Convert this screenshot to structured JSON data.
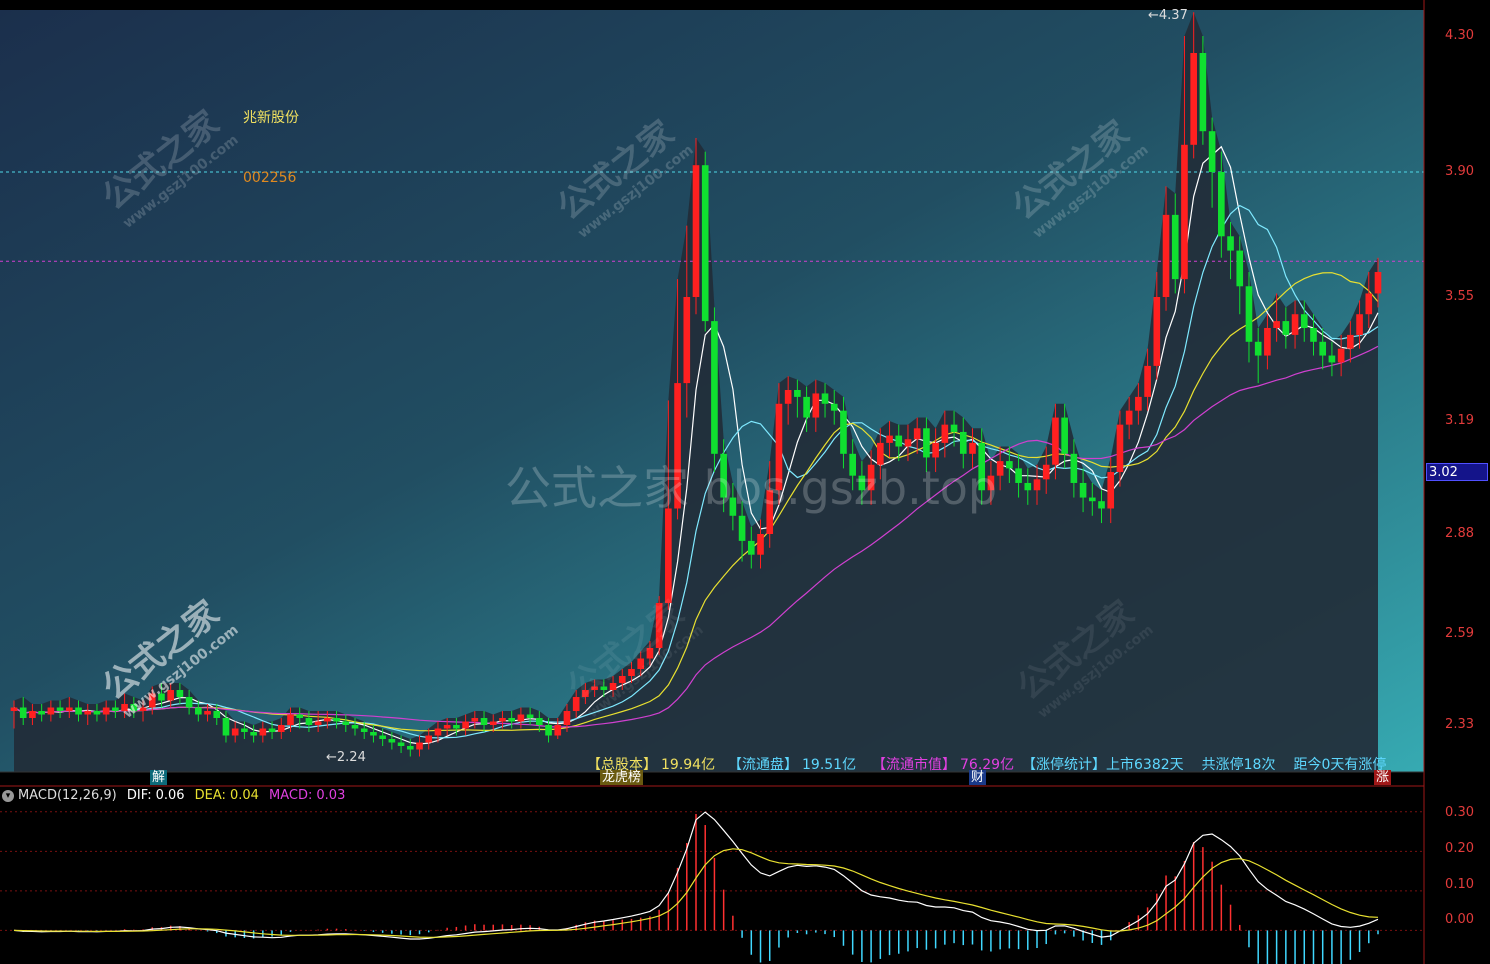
{
  "stock": {
    "name": "兆新股份",
    "code": "002256"
  },
  "colors": {
    "up": "#ff2020",
    "down": "#10e030",
    "ma5": "#ffffff",
    "ma10": "#7fe9ff",
    "ma20": "#e8e030",
    "ma60": "#d040d0",
    "axis": "#e23b3b",
    "dif": "#ffffff",
    "dea": "#e8e030",
    "macd": "#d040d0"
  },
  "price_axis": {
    "ticks": [
      "4.30",
      "3.90",
      "3.55",
      "3.19",
      "2.88",
      "2.59",
      "2.33"
    ],
    "current": "3.02"
  },
  "annotations": {
    "high": "4.37",
    "low": "2.24"
  },
  "markers": {
    "m1": "解",
    "m2": "龙虎榜",
    "m3": "财",
    "m4": "涨"
  },
  "stats": {
    "total_label": "【总股本】",
    "total_value": "19.94亿",
    "float_label": "【流通盘】",
    "float_value": "19.51亿",
    "mcap_label": "【流通市值】",
    "mcap_value": "76.29亿",
    "limit_label": "【涨停统计】",
    "limit_value": "上市6382天",
    "limit_count": "共涨停18次",
    "limit_recent": "距今0天有涨停"
  },
  "macd": {
    "title": "MACD(12,26,9)",
    "dif_label": "DIF:",
    "dif_value": "0.06",
    "dea_label": "DEA:",
    "dea_value": "0.04",
    "macd_label": "MACD:",
    "macd_value": "0.03",
    "ticks": [
      "0.30",
      "0.20",
      "0.10",
      "0.00"
    ]
  },
  "watermark": {
    "center": "公式之家 bbs.gszb.top",
    "corner_cn": "公式之家",
    "corner_url": "www.gszj100.com"
  },
  "chart_data": {
    "type": "candlestick",
    "candles": [
      [
        2.37,
        2.38,
        2.32,
        2.4
      ],
      [
        2.38,
        2.35,
        2.33,
        2.41
      ],
      [
        2.35,
        2.37,
        2.33,
        2.39
      ],
      [
        2.37,
        2.36,
        2.34,
        2.39
      ],
      [
        2.36,
        2.38,
        2.34,
        2.4
      ],
      [
        2.38,
        2.37,
        2.35,
        2.4
      ],
      [
        2.37,
        2.38,
        2.35,
        2.41
      ],
      [
        2.38,
        2.36,
        2.34,
        2.4
      ],
      [
        2.36,
        2.37,
        2.33,
        2.39
      ],
      [
        2.37,
        2.36,
        2.34,
        2.39
      ],
      [
        2.36,
        2.38,
        2.34,
        2.4
      ],
      [
        2.38,
        2.37,
        2.35,
        2.4
      ],
      [
        2.37,
        2.39,
        2.35,
        2.42
      ],
      [
        2.39,
        2.37,
        2.35,
        2.41
      ],
      [
        2.37,
        2.38,
        2.34,
        2.4
      ],
      [
        2.38,
        2.42,
        2.36,
        2.44
      ],
      [
        2.42,
        2.4,
        2.38,
        2.45
      ],
      [
        2.4,
        2.43,
        2.38,
        2.45
      ],
      [
        2.43,
        2.41,
        2.39,
        2.45
      ],
      [
        2.41,
        2.38,
        2.36,
        2.43
      ],
      [
        2.38,
        2.36,
        2.34,
        2.4
      ],
      [
        2.36,
        2.37,
        2.34,
        2.39
      ],
      [
        2.37,
        2.35,
        2.33,
        2.39
      ],
      [
        2.35,
        2.3,
        2.28,
        2.37
      ],
      [
        2.3,
        2.32,
        2.28,
        2.34
      ],
      [
        2.32,
        2.31,
        2.29,
        2.34
      ],
      [
        2.31,
        2.3,
        2.28,
        2.33
      ],
      [
        2.3,
        2.32,
        2.28,
        2.34
      ],
      [
        2.32,
        2.31,
        2.29,
        2.34
      ],
      [
        2.31,
        2.33,
        2.29,
        2.35
      ],
      [
        2.33,
        2.36,
        2.31,
        2.38
      ],
      [
        2.36,
        2.35,
        2.32,
        2.38
      ],
      [
        2.35,
        2.33,
        2.31,
        2.37
      ],
      [
        2.33,
        2.34,
        2.31,
        2.37
      ],
      [
        2.34,
        2.35,
        2.32,
        2.37
      ],
      [
        2.35,
        2.34,
        2.32,
        2.37
      ],
      [
        2.34,
        2.33,
        2.31,
        2.36
      ],
      [
        2.33,
        2.32,
        2.3,
        2.35
      ],
      [
        2.32,
        2.31,
        2.29,
        2.34
      ],
      [
        2.31,
        2.3,
        2.28,
        2.33
      ],
      [
        2.3,
        2.29,
        2.27,
        2.32
      ],
      [
        2.29,
        2.28,
        2.26,
        2.31
      ],
      [
        2.28,
        2.27,
        2.25,
        2.3
      ],
      [
        2.27,
        2.26,
        2.24,
        2.29
      ],
      [
        2.26,
        2.28,
        2.24,
        2.3
      ],
      [
        2.28,
        2.3,
        2.26,
        2.32
      ],
      [
        2.3,
        2.32,
        2.28,
        2.34
      ],
      [
        2.32,
        2.33,
        2.3,
        2.35
      ],
      [
        2.33,
        2.32,
        2.3,
        2.35
      ],
      [
        2.32,
        2.34,
        2.3,
        2.36
      ],
      [
        2.34,
        2.35,
        2.32,
        2.37
      ],
      [
        2.35,
        2.33,
        2.31,
        2.37
      ],
      [
        2.33,
        2.34,
        2.31,
        2.36
      ],
      [
        2.34,
        2.35,
        2.32,
        2.37
      ],
      [
        2.35,
        2.34,
        2.32,
        2.37
      ],
      [
        2.34,
        2.36,
        2.32,
        2.38
      ],
      [
        2.36,
        2.35,
        2.33,
        2.38
      ],
      [
        2.35,
        2.33,
        2.31,
        2.37
      ],
      [
        2.33,
        2.3,
        2.28,
        2.35
      ],
      [
        2.3,
        2.33,
        2.29,
        2.35
      ],
      [
        2.33,
        2.37,
        2.31,
        2.39
      ],
      [
        2.37,
        2.41,
        2.35,
        2.43
      ],
      [
        2.41,
        2.43,
        2.39,
        2.45
      ],
      [
        2.43,
        2.44,
        2.41,
        2.46
      ],
      [
        2.44,
        2.43,
        2.41,
        2.46
      ],
      [
        2.43,
        2.45,
        2.41,
        2.47
      ],
      [
        2.45,
        2.47,
        2.43,
        2.49
      ],
      [
        2.47,
        2.49,
        2.45,
        2.51
      ],
      [
        2.49,
        2.52,
        2.47,
        2.54
      ],
      [
        2.52,
        2.55,
        2.5,
        2.57
      ],
      [
        2.55,
        2.68,
        2.53,
        2.7
      ],
      [
        2.68,
        2.95,
        2.66,
        3.25
      ],
      [
        2.95,
        3.3,
        2.92,
        3.6
      ],
      [
        3.3,
        3.55,
        3.2,
        3.75
      ],
      [
        3.55,
        3.92,
        3.5,
        4.0
      ],
      [
        3.92,
        3.48,
        3.45,
        3.96
      ],
      [
        3.48,
        3.1,
        3.05,
        3.52
      ],
      [
        3.1,
        2.98,
        2.94,
        3.14
      ],
      [
        2.98,
        2.93,
        2.89,
        3.02
      ],
      [
        2.93,
        2.86,
        2.8,
        2.97
      ],
      [
        2.86,
        2.82,
        2.78,
        2.9
      ],
      [
        2.82,
        2.88,
        2.78,
        2.92
      ],
      [
        2.88,
        3.0,
        2.84,
        3.08
      ],
      [
        3.0,
        3.24,
        2.96,
        3.3
      ],
      [
        3.24,
        3.28,
        3.18,
        3.32
      ],
      [
        3.28,
        3.26,
        3.2,
        3.31
      ],
      [
        3.26,
        3.2,
        3.16,
        3.29
      ],
      [
        3.2,
        3.27,
        3.16,
        3.31
      ],
      [
        3.27,
        3.24,
        3.2,
        3.3
      ],
      [
        3.24,
        3.22,
        3.18,
        3.28
      ],
      [
        3.22,
        3.1,
        3.06,
        3.26
      ],
      [
        3.1,
        3.04,
        3.0,
        3.14
      ],
      [
        3.04,
        3.0,
        2.96,
        3.08
      ],
      [
        3.0,
        3.07,
        2.96,
        3.11
      ],
      [
        3.07,
        3.13,
        3.03,
        3.17
      ],
      [
        3.13,
        3.15,
        3.09,
        3.19
      ],
      [
        3.15,
        3.12,
        3.08,
        3.18
      ],
      [
        3.12,
        3.14,
        3.08,
        3.18
      ],
      [
        3.14,
        3.17,
        3.1,
        3.2
      ],
      [
        3.17,
        3.09,
        3.05,
        3.2
      ],
      [
        3.09,
        3.13,
        3.05,
        3.17
      ],
      [
        3.13,
        3.18,
        3.09,
        3.22
      ],
      [
        3.18,
        3.16,
        3.12,
        3.22
      ],
      [
        3.16,
        3.1,
        3.06,
        3.2
      ],
      [
        3.1,
        3.13,
        3.06,
        3.17
      ],
      [
        3.13,
        3.0,
        2.96,
        3.17
      ],
      [
        3.0,
        3.04,
        2.96,
        3.08
      ],
      [
        3.04,
        3.08,
        3.0,
        3.12
      ],
      [
        3.08,
        3.06,
        3.02,
        3.12
      ],
      [
        3.06,
        3.02,
        2.98,
        3.1
      ],
      [
        3.02,
        3.0,
        2.96,
        3.06
      ],
      [
        3.0,
        3.03,
        2.96,
        3.07
      ],
      [
        3.03,
        3.07,
        2.99,
        3.12
      ],
      [
        3.07,
        3.2,
        3.03,
        3.24
      ],
      [
        3.2,
        3.1,
        3.06,
        3.24
      ],
      [
        3.1,
        3.02,
        2.98,
        3.14
      ],
      [
        3.02,
        2.98,
        2.94,
        3.06
      ],
      [
        2.98,
        2.97,
        2.93,
        3.02
      ],
      [
        2.97,
        2.95,
        2.91,
        3.0
      ],
      [
        2.95,
        3.05,
        2.91,
        3.09
      ],
      [
        3.05,
        3.18,
        3.01,
        3.22
      ],
      [
        3.18,
        3.22,
        3.14,
        3.26
      ],
      [
        3.22,
        3.26,
        3.18,
        3.3
      ],
      [
        3.26,
        3.35,
        3.22,
        3.4
      ],
      [
        3.35,
        3.55,
        3.31,
        3.62
      ],
      [
        3.55,
        3.78,
        3.51,
        3.86
      ],
      [
        3.78,
        3.6,
        3.56,
        3.84
      ],
      [
        3.6,
        3.98,
        3.56,
        4.3
      ],
      [
        3.98,
        4.25,
        3.94,
        4.37
      ],
      [
        4.25,
        4.02,
        3.98,
        4.3
      ],
      [
        4.02,
        3.9,
        3.8,
        4.06
      ],
      [
        3.9,
        3.72,
        3.66,
        3.96
      ],
      [
        3.72,
        3.68,
        3.6,
        3.76
      ],
      [
        3.68,
        3.58,
        3.5,
        3.72
      ],
      [
        3.58,
        3.42,
        3.36,
        3.62
      ],
      [
        3.42,
        3.38,
        3.3,
        3.46
      ],
      [
        3.38,
        3.46,
        3.34,
        3.5
      ],
      [
        3.46,
        3.48,
        3.42,
        3.56
      ],
      [
        3.48,
        3.44,
        3.4,
        3.52
      ],
      [
        3.44,
        3.5,
        3.4,
        3.54
      ],
      [
        3.5,
        3.46,
        3.42,
        3.54
      ],
      [
        3.46,
        3.42,
        3.38,
        3.5
      ],
      [
        3.42,
        3.38,
        3.34,
        3.46
      ],
      [
        3.38,
        3.36,
        3.32,
        3.42
      ],
      [
        3.36,
        3.4,
        3.32,
        3.44
      ],
      [
        3.4,
        3.44,
        3.36,
        3.48
      ],
      [
        3.44,
        3.5,
        3.4,
        3.54
      ],
      [
        3.5,
        3.56,
        3.46,
        3.62
      ],
      [
        3.56,
        3.62,
        3.52,
        3.66
      ]
    ],
    "ylim": [
      2.1,
      4.45
    ],
    "y_ticks": [
      4.3,
      3.9,
      3.55,
      3.19,
      2.88,
      2.59,
      2.33
    ],
    "macd_ylim": [
      -0.08,
      0.34
    ],
    "macd_ticks": [
      0.3,
      0.2,
      0.1,
      0.0
    ],
    "grid": true
  }
}
